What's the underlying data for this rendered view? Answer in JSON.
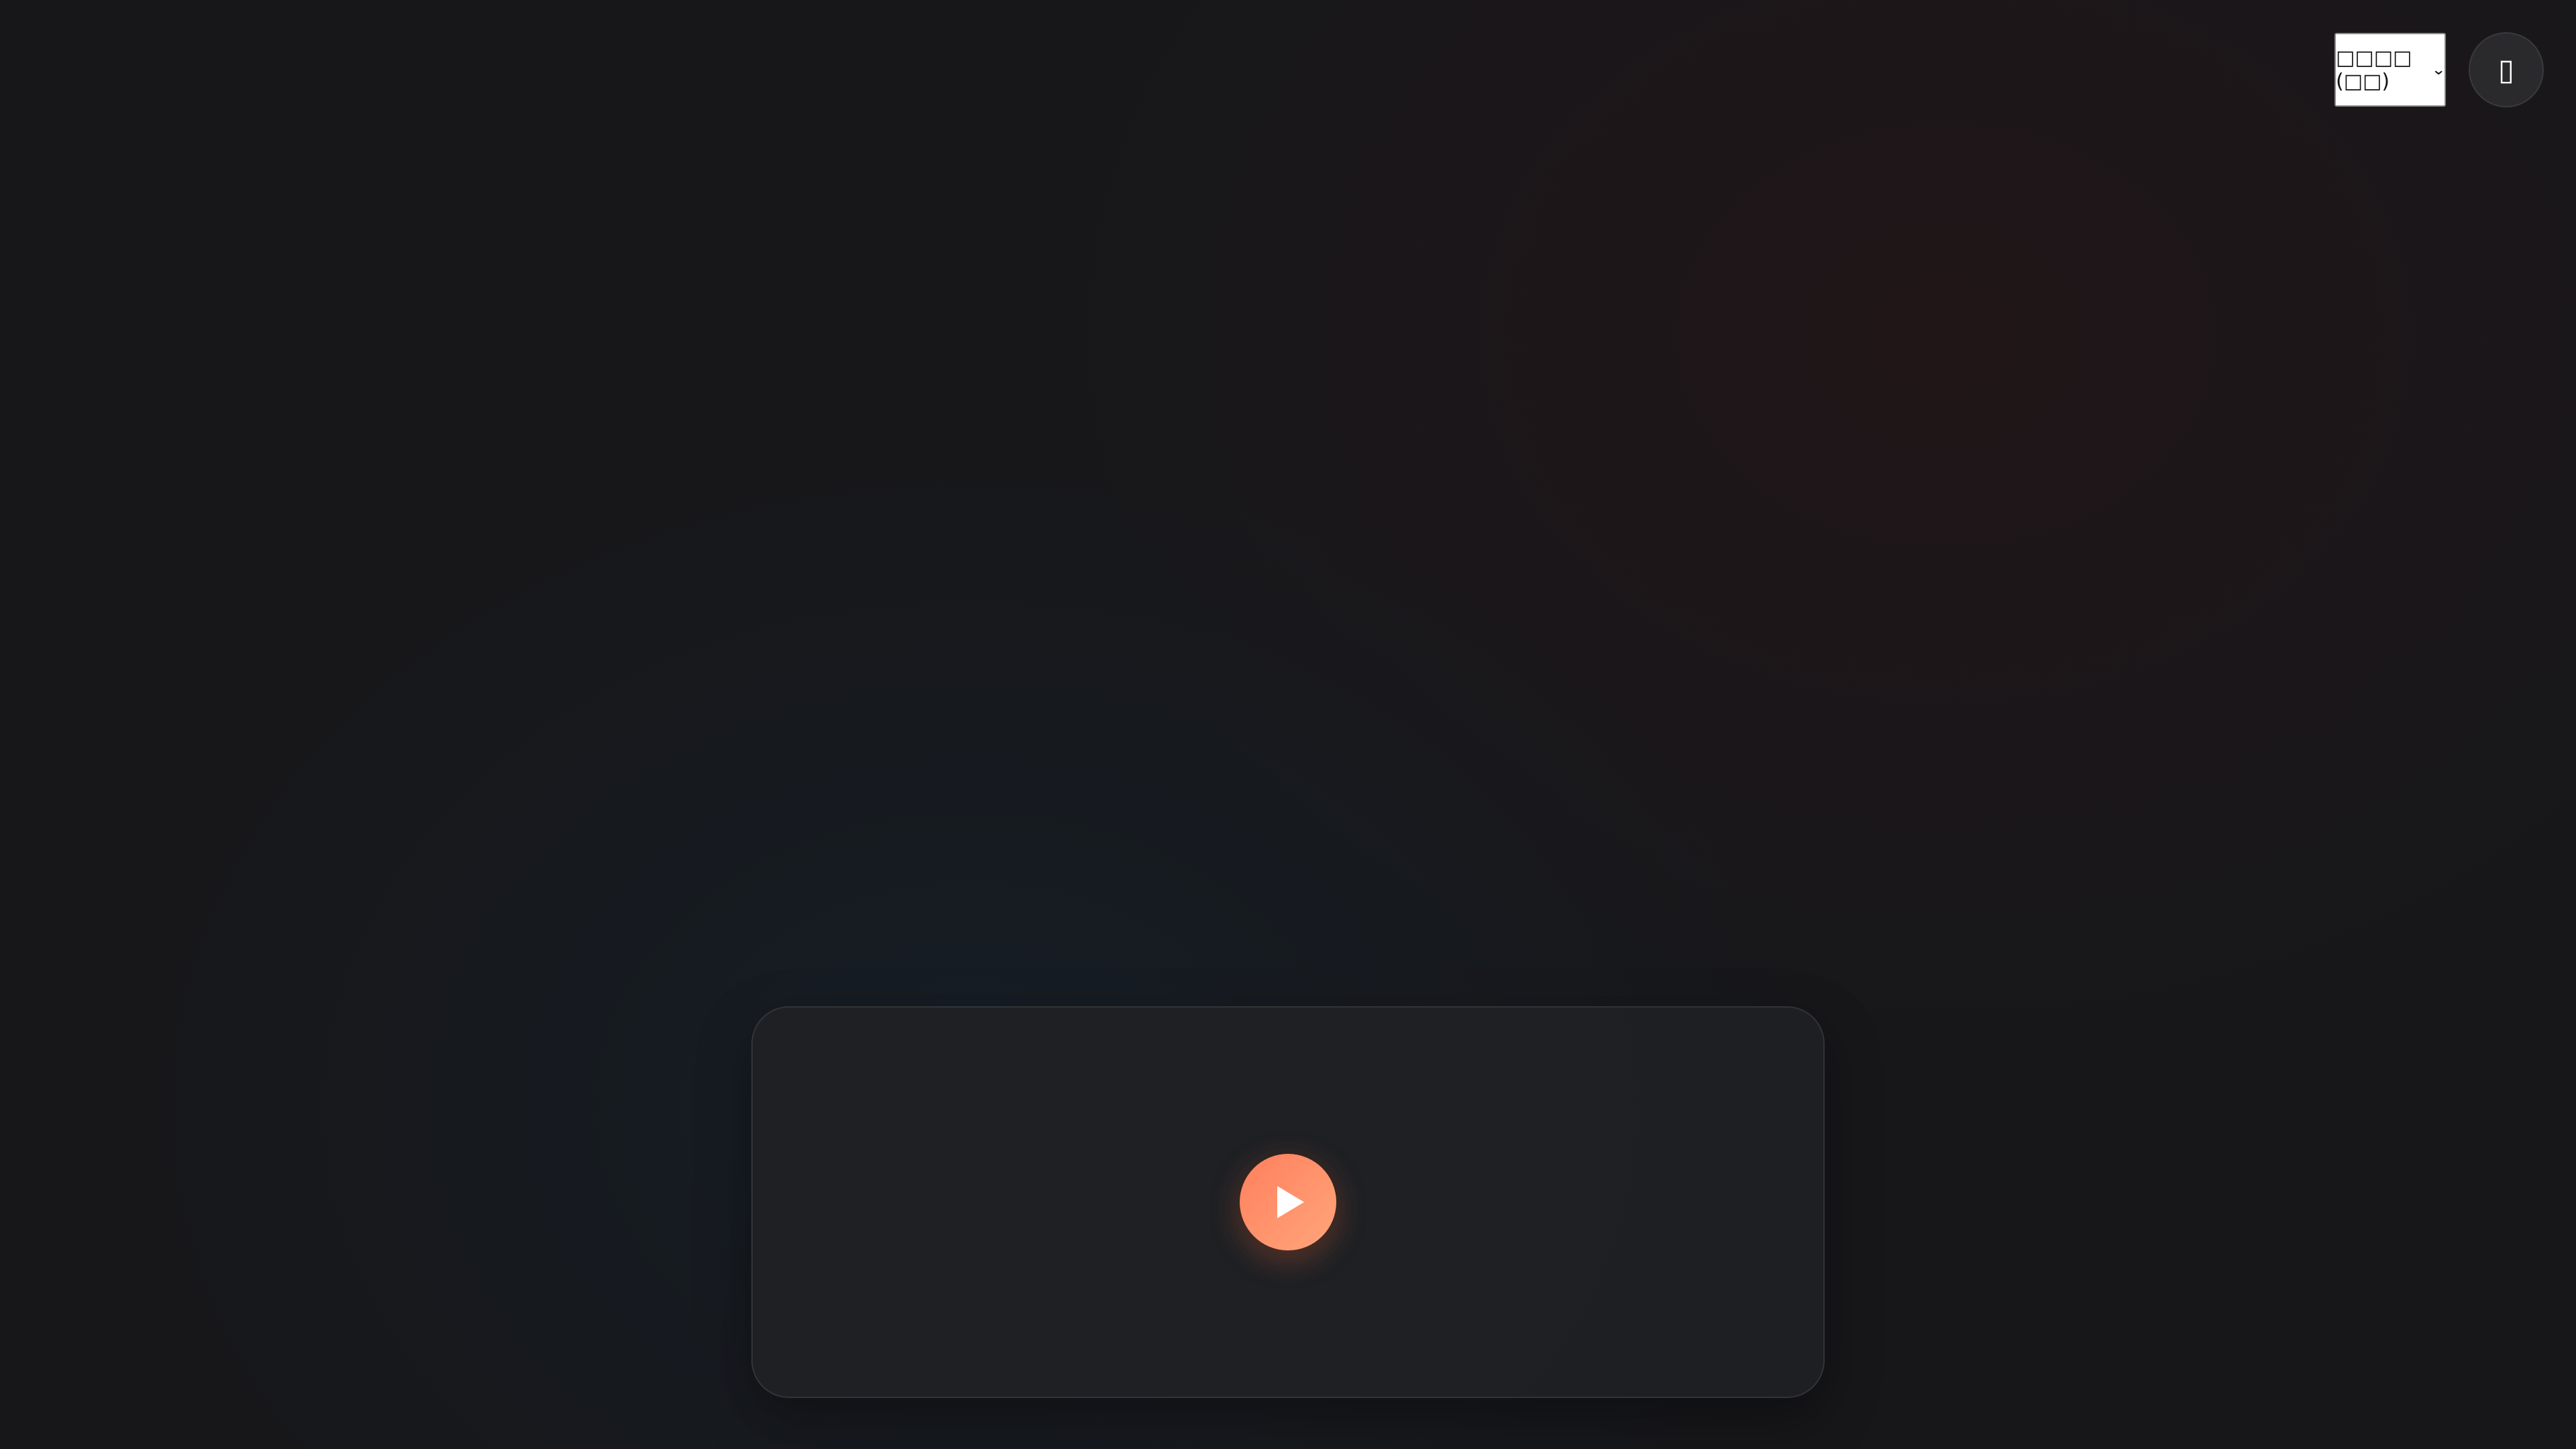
{
  "header": {
    "language_select": {
      "selected": "□□□□ (□□)",
      "chevron_icon": "chevron-down-icon"
    },
    "round_button": {
      "label": "▯",
      "icon": "unknown-icon"
    }
  },
  "player": {
    "play_icon": "play-icon",
    "accent_color": "#ff8a65"
  }
}
